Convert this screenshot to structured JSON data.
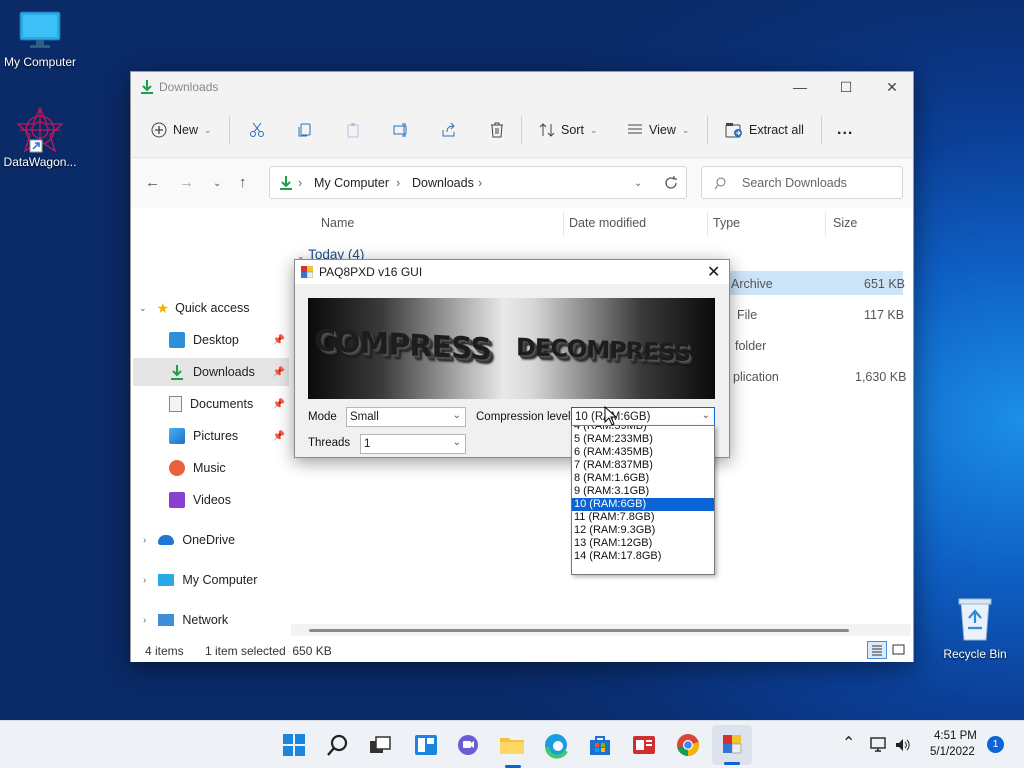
{
  "desktop": {
    "icons": [
      {
        "label": "My Computer"
      },
      {
        "label": "DataWagon..."
      },
      {
        "label": "Recycle Bin"
      }
    ]
  },
  "explorer": {
    "title": "Downloads",
    "commands": {
      "new": "New",
      "sort": "Sort",
      "view": "View",
      "extract_all": "Extract all",
      "more": "..."
    },
    "address": {
      "crumbs": [
        "My Computer",
        "Downloads"
      ],
      "search_placeholder": "Search Downloads"
    },
    "nav": {
      "quick_access": "Quick access",
      "items": [
        "Desktop",
        "Downloads",
        "Documents",
        "Pictures",
        "Music",
        "Videos"
      ],
      "roots": [
        "OneDrive",
        "My Computer",
        "Network"
      ]
    },
    "columns": {
      "name": "Name",
      "date": "Date modified",
      "type": "Type",
      "size": "Size"
    },
    "group": "Today (4)",
    "files": [
      {
        "type": "Archive",
        "size": "651 KB"
      },
      {
        "type": "File",
        "size": "117 KB"
      },
      {
        "type": "folder",
        "size": ""
      },
      {
        "type": "plication",
        "size": "1,630 KB"
      }
    ],
    "status": {
      "count": "4 items",
      "selection": "1 item selected  650 KB"
    }
  },
  "dialog": {
    "title": "PAQ8PXD v16 GUI",
    "banner": {
      "word1": "COMPRESS",
      "word2": "DECOMPRESS"
    },
    "mode_label": "Mode",
    "mode_value": "Small",
    "level_label": "Compression level",
    "level_value": "10 (RAM:6GB)",
    "threads_label": "Threads",
    "threads_value": "1",
    "level_options": [
      "4 (RAM:59MB)",
      "5 (RAM:233MB)",
      "6 (RAM:435MB)",
      "7 (RAM:837MB)",
      "8 (RAM:1.6GB)",
      "9 (RAM:3.1GB)",
      "10 (RAM:6GB)",
      "11 (RAM:7.8GB)",
      "12 (RAM:9.3GB)",
      "13 (RAM:12GB)",
      "14 (RAM:17.8GB)"
    ],
    "selected_index": 6
  },
  "taskbar": {
    "time": "4:51 PM",
    "date": "5/1/2022",
    "notification_count": "1"
  },
  "colors": {
    "accent": "#0a64d6",
    "taskbar": "#eef1f6",
    "download_green": "#1e9e4a"
  }
}
